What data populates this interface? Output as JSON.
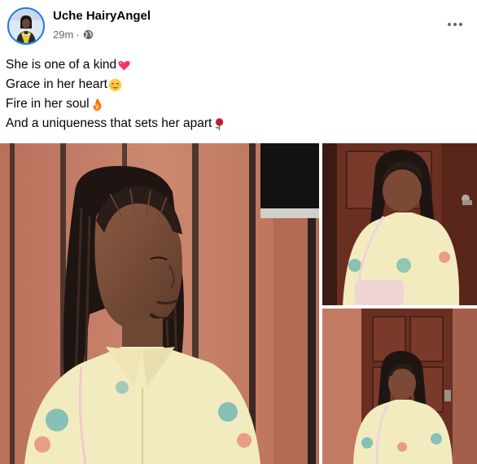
{
  "post": {
    "author_name": "Uche HairyAngel",
    "timestamp": "29m",
    "separator": "·",
    "privacy_icon": "globe-icon",
    "more_icon": "more-options-icon",
    "caption": {
      "line1": "She is one of a kind",
      "line1_emoji": "sparkling-heart-emoji",
      "line2": "Grace in her heart",
      "line2_emoji": "relieved-face-emoji",
      "line3": "Fire in her soul",
      "line3_emoji": "fire-emoji",
      "line4": "And a uniqueness that sets her apart",
      "line4_emoji": "rose-emoji"
    },
    "photos": [
      {
        "id": "main",
        "description_icon": "photo-woman-braids-portrait"
      },
      {
        "id": "top-right",
        "description_icon": "photo-woman-looking-down"
      },
      {
        "id": "bottom-right",
        "description_icon": "photo-woman-by-door"
      }
    ]
  },
  "colors": {
    "accent": "#1877f2",
    "secondary_text": "#65676b",
    "primary_text": "#050505",
    "wall": "#c27a63",
    "door": "#6b2f22",
    "shirt": "#f3ebc0",
    "shirt_pattern": "#6cb5b0"
  }
}
